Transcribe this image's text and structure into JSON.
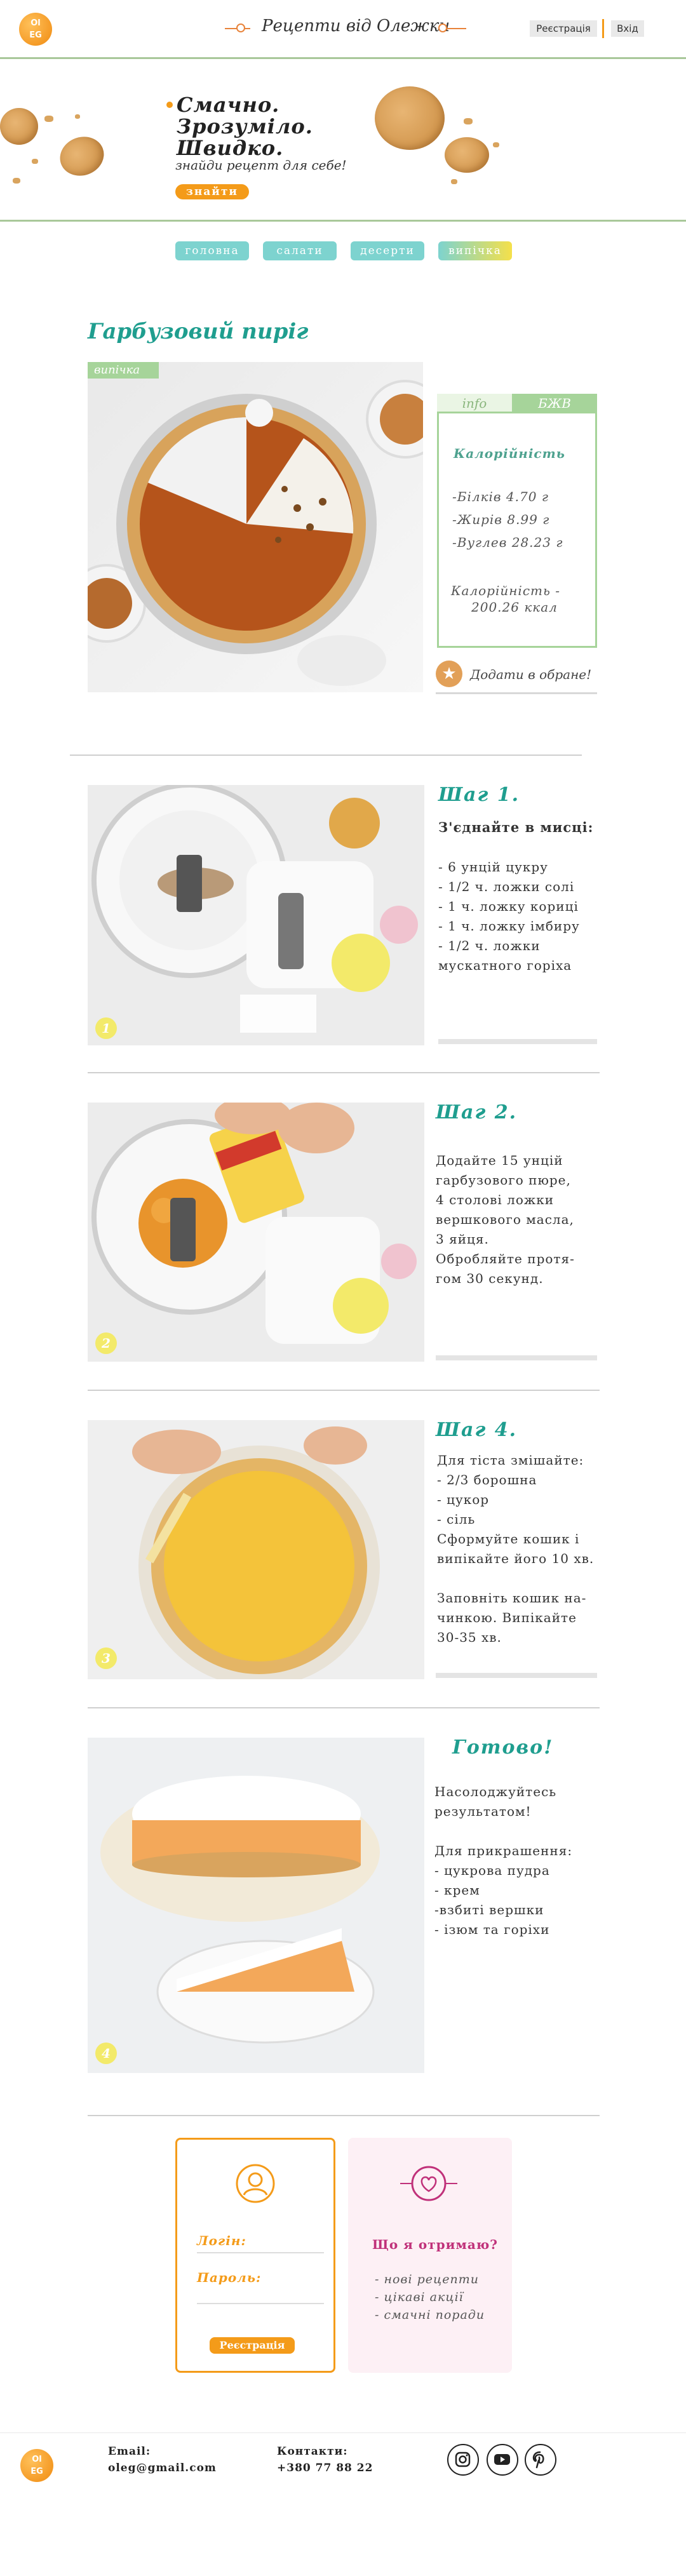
{
  "header": {
    "logo_text": "Ol\nEG",
    "site_title": "Рецепти від Олежки",
    "register_label": "Реєстрація",
    "login_label": "Вхід"
  },
  "hero": {
    "line1": "Смачно.",
    "line2": "Зрозуміло.",
    "line3": "Швидко.",
    "subtitle": "знайди рецепт для себе!",
    "find_button": "знайти"
  },
  "nav": {
    "items": [
      {
        "label": "головна",
        "color": "#7dd3cf"
      },
      {
        "label": "салати",
        "color": "#7dd3cf"
      },
      {
        "label": "десерти",
        "color": "#7dd3cf"
      },
      {
        "label": "випічка",
        "color": "#8fd0a8"
      }
    ]
  },
  "recipe": {
    "title": "Гарбузовий пиріг",
    "category_badge": "випічка",
    "tab_info": "info",
    "tab_bzhv": "БЖВ",
    "calories_title": "Калорійність",
    "proteins": "-Білків  4.70 г",
    "fats": "-Жирів  8.99 г",
    "carbs": "-Вуглев 28.23 г",
    "calories_total_label": "Калорійність -",
    "calories_total_value": "200.26 ккал",
    "favorite_label": "Додати в обране!"
  },
  "steps": [
    {
      "title": "Шаг 1.",
      "number": "1",
      "heading": "З'єднайте в мисці:",
      "text": "- 6 унцій цукру\n- 1/2 ч. ложки солі\n- 1 ч. ложку кориці\n- 1 ч. ложку імбиру\n- 1/2 ч. ложки\nмускатного горіха"
    },
    {
      "title": "Шаг 2.",
      "number": "2",
      "text": "Додайте 15 унцій\nгарбузового пюре,\n4 столові ложки\nвершкового масла,\n3 яйця.\nОбробляйте протя-\nгом 30 секунд."
    },
    {
      "title": "Шаг 4.",
      "number": "3",
      "text": "Для тіста змішайте:\n- 2/3 борошна\n- цукор\n- сіль\nСформуйте кошик і\nвипікайте його 10 хв.\n\nЗаповніть кошик на-\nчинкою. Випікайте\n30-35 хв."
    },
    {
      "title": "Готово!",
      "number": "4",
      "text": "Насолоджуйтесь\nрезультатом!\n\nДля прикрашення:\n- цукрова пудра\n- крем\n-взбиті вершки\n- ізюм та горіхи"
    }
  ],
  "login_card": {
    "login_label": "Логін:",
    "password_label": "Пароль:",
    "register_button": "Реєстрація"
  },
  "benefits_card": {
    "title": "Що я отримаю?",
    "items": [
      "- нові рецепти",
      "- цікаві акції",
      "- смачні поради"
    ]
  },
  "footer": {
    "logo_text": "Ol\nEG",
    "email_label": "Email:",
    "email_value": "oleg@gmail.com",
    "contacts_label": "Контакти:",
    "contacts_value": "+380 77 88 22",
    "social_icons": [
      "instagram-icon",
      "youtube-icon",
      "pinterest-icon"
    ]
  }
}
